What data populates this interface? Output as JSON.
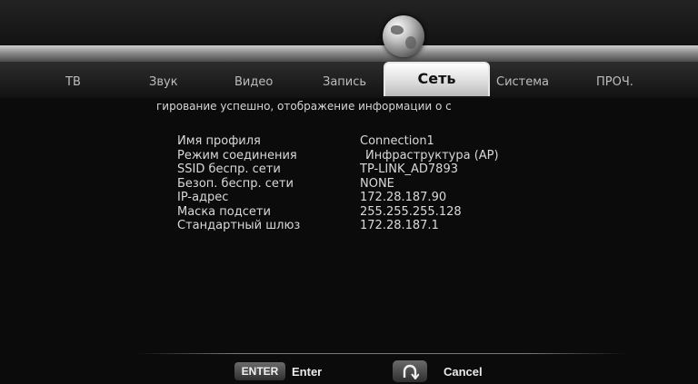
{
  "tabs": {
    "tv": "ТВ",
    "sound": "Звук",
    "video": "Видео",
    "record": "Запись",
    "network": "Сеть",
    "system": "Система",
    "other": "ПРОЧ."
  },
  "status_message": "гирование успешно, отображение информации о с",
  "network_info": {
    "rows": [
      {
        "label": "Имя профиля",
        "value": "Connection1"
      },
      {
        "label": "Режим соединения",
        "value": "Инфраструктура (AP)"
      },
      {
        "label": "SSID беспр. сети",
        "value": "TP-LINK_AD7893"
      },
      {
        "label": "Безоп. беспр. сети",
        "value": "NONE"
      },
      {
        "label": "IP-адрес",
        "value": "172.28.187.90"
      },
      {
        "label": "Маска подсети",
        "value": "255.255.255.128"
      },
      {
        "label": "Стандартный шлюз",
        "value": "172.28.187.1"
      }
    ]
  },
  "footer": {
    "enter_key": "ENTER",
    "enter_label": "Enter",
    "cancel_icon": "return-arrow-icon",
    "cancel_label": "Cancel"
  }
}
